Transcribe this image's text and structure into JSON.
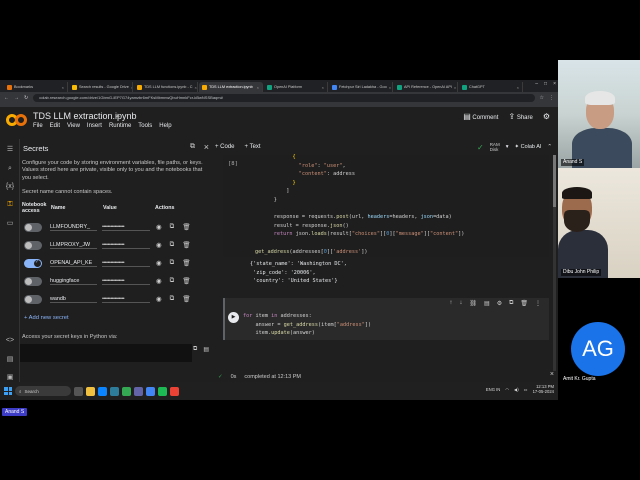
{
  "browser": {
    "tabs": [
      {
        "label": "Bookmarks",
        "color": "#e8710a",
        "active": false
      },
      {
        "label": "Search results - Google Drive",
        "color": "#fbbc04",
        "active": false
      },
      {
        "label": "TDS LLM functions.ipynb - C",
        "color": "#f9ab00",
        "active": false
      },
      {
        "label": "TDS LLM extraction.ipynb",
        "color": "#f9ab00",
        "active": true
      },
      {
        "label": "OpenAI Platform",
        "color": "#10a37f",
        "active": false
      },
      {
        "label": "Fetchpur Siri Ladakha - Goo",
        "color": "#4285f4",
        "active": false
      },
      {
        "label": "API Reference - OpenAI API",
        "color": "#10a37f",
        "active": false
      },
      {
        "label": "ChatGPT",
        "color": "#10a37f",
        "active": false
      }
    ],
    "url": "colab.research.google.com/drive/1GbmG-lEP7G74yamzbr6mFKsMbmnwQbuHmnkFcr-kBwNSSBaqm#"
  },
  "colab": {
    "notebook_title": "TDS LLM extraction.ipynb",
    "menu": [
      "File",
      "Edit",
      "View",
      "Insert",
      "Runtime",
      "Tools",
      "Help"
    ],
    "comment_label": "Comment",
    "share_label": "Share",
    "add_code_label": "+ Code",
    "add_text_label": "+ Text",
    "ram_label": "RAM",
    "disk_label": "Disk",
    "colab_ai_label": "Colab AI"
  },
  "secrets": {
    "title": "Secrets",
    "description": "Configure your code by storing environment variables, file paths, or keys. Values stored here are private, visible only to you and the notebooks that you select.",
    "note": "Secret name cannot contain spaces.",
    "columns": {
      "access": "Notebook access",
      "name": "Name",
      "value": "Value",
      "actions": "Actions"
    },
    "items": [
      {
        "name": "LLMFOUNDRY_",
        "value": "••••••••••••••••",
        "enabled": false
      },
      {
        "name": "LLMPROXY_JW",
        "value": "••••••••••••••••",
        "enabled": false
      },
      {
        "name": "OPENAI_API_KE",
        "value": "••••••••••••••••",
        "enabled": true
      },
      {
        "name": "huggingface",
        "value": "••••••••••••••••",
        "enabled": false
      },
      {
        "name": "wandb",
        "value": "••••••••••••••••",
        "enabled": false
      }
    ],
    "add_label": "+ Add new secret",
    "access_note": "Access your secret keys in Python via:"
  },
  "cell1": {
    "exec_count": "[8]"
  },
  "output_lines": [
    "{'state_name': 'Washington DC',",
    " 'zip_code': '20006',",
    " 'country': 'United States'}"
  ],
  "statusbar": {
    "check": "✓",
    "time": "0s",
    "text": "completed at 12:13 PM"
  },
  "taskbar": {
    "search_placeholder": "Search",
    "time": "12:13 PM",
    "date": "17-05-2024",
    "lang": "ENG IN"
  },
  "participants": {
    "p1": "Anand S",
    "p2": "Dibu John Philip",
    "p3_initials": "AG",
    "p3": "Amit Kr. Gupta"
  },
  "speaker": "Anand S"
}
